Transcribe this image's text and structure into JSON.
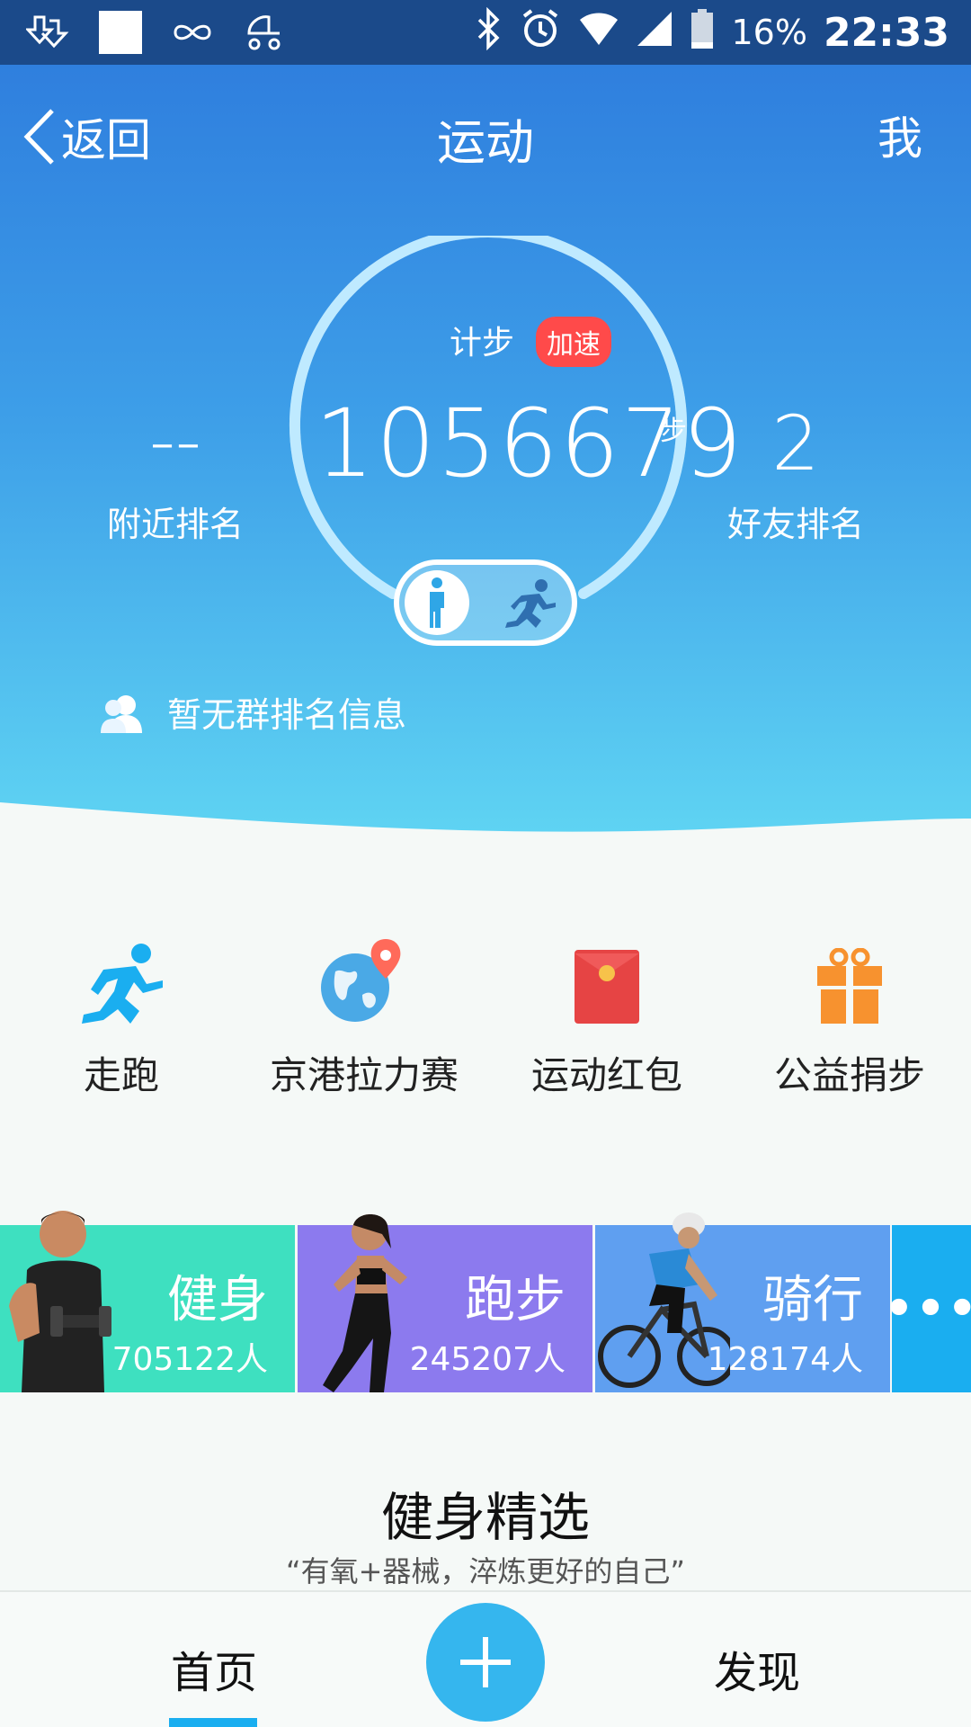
{
  "status_bar": {
    "battery": "16%",
    "time": "22:33",
    "icons": [
      "download-icon",
      "notification-square-icon",
      "infinity-icon",
      "stroller-icon",
      "bluetooth-icon",
      "alarm-icon",
      "wifi-icon",
      "signal-icon",
      "battery-icon"
    ]
  },
  "header": {
    "back_label": "返回",
    "title": "运动",
    "me_label": "我"
  },
  "stats": {
    "step_label": "计步",
    "speed_badge": "加速",
    "step_count": "1056679",
    "step_unit": "步",
    "nearby_rank_value": "--",
    "nearby_rank_label": "附近排名",
    "friend_rank_value": "2",
    "friend_rank_label": "好友排名",
    "ring_progress": 0.78,
    "mode_selected": "walk"
  },
  "group_info": "暂无群排名信息",
  "actions": [
    {
      "label": "走跑",
      "icon": "runner-icon",
      "color": "#1aaef0"
    },
    {
      "label": "京港拉力赛",
      "icon": "globe-pin-icon",
      "color": "#4aa9e6"
    },
    {
      "label": "运动红包",
      "icon": "red-envelope-icon",
      "color": "#e64444"
    },
    {
      "label": "公益捐步",
      "icon": "gift-icon",
      "color": "#f7922f"
    }
  ],
  "categories": [
    {
      "name": "健身",
      "count": "705122人",
      "color": "#3ee0c0"
    },
    {
      "name": "跑步",
      "count": "245207人",
      "color": "#8c7aee"
    },
    {
      "name": "骑行",
      "count": "128174人",
      "color": "#5f9ff0"
    }
  ],
  "more_label": "•••",
  "featured": {
    "title": "健身精选",
    "subtitle": "“有氧+器械，淬炼更好的自己”"
  },
  "bottom_nav": {
    "home": "首页",
    "discover": "发现"
  }
}
